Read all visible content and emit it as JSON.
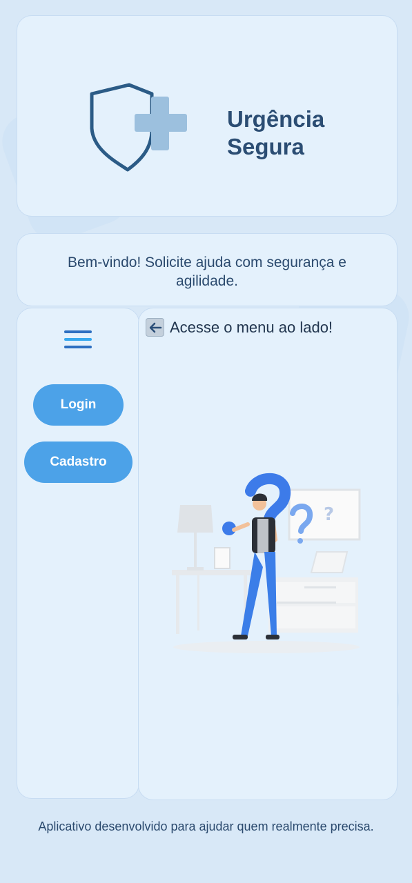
{
  "app": {
    "title": "Urgência Segura"
  },
  "icons": {
    "logo": "shield-plus-icon",
    "menu": "hamburger-menu-icon",
    "hint": "left-arrow-icon"
  },
  "colors": {
    "accent": "#4ca2e8",
    "title": "#2b4d73",
    "card": "#e4f1fc",
    "background": "#d8e8f7"
  },
  "welcome": {
    "text": "Bem-vindo! Solicite ajuda com segurança e agilidade."
  },
  "sidebar": {
    "login_label": "Login",
    "signup_label": "Cadastro"
  },
  "main": {
    "hint_text": "Acesse o menu ao lado!"
  },
  "footer": {
    "text": "Aplicativo desenvolvido para ajudar quem realmente precisa."
  }
}
